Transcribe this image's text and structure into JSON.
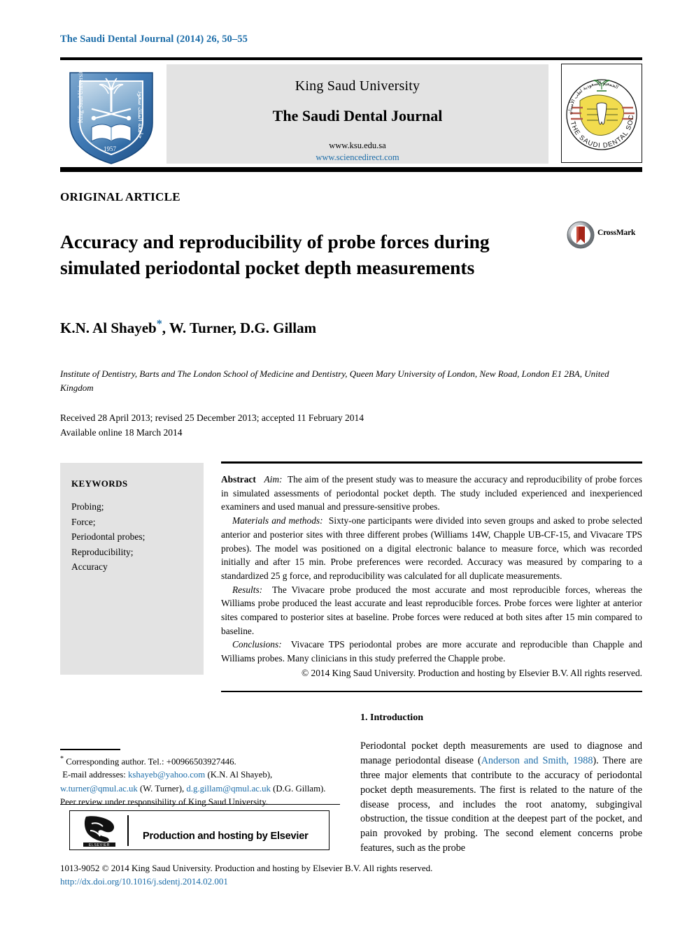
{
  "running_head": "The Saudi Dental Journal (2014) 26, 50–55",
  "masthead": {
    "university": "King Saud University",
    "journal_name": "The Saudi Dental Journal",
    "url_primary": "www.ksu.edu.sa",
    "url_secondary": "www.sciencedirect.com",
    "ksu_logo_name": "King Saud University",
    "ksu_logo_year": "1957",
    "sds_logo_text": "THE SAUDI DENTAL SOCIETY"
  },
  "article": {
    "type": "ORIGINAL ARTICLE",
    "title": "Accuracy and reproducibility of probe forces during simulated periodontal pocket depth measurements",
    "crossmark_label": "CrossMark",
    "authors": "K.N. Al Shayeb",
    "authors_rest": ", W. Turner, D.G. Gillam",
    "corresponding_marker": "*",
    "affiliation": "Institute of Dentistry, Barts and The London School of Medicine and Dentistry, Queen Mary University of London, New Road, London E1 2BA, United Kingdom",
    "received_line": "Received 28 April 2013; revised 25 December 2013; accepted 11 February 2014",
    "available_line": "Available online 18 March 2014"
  },
  "keywords": {
    "title": "KEYWORDS",
    "items": [
      "Probing;",
      "Force;",
      "Periodontal probes;",
      "Reproducibility;",
      "Accuracy"
    ]
  },
  "abstract": {
    "heading": "Abstract",
    "aim_label": "Aim:",
    "aim_text": "The aim of the present study was to measure the accuracy and reproducibility of probe forces in simulated assessments of periodontal pocket depth. The study included experienced and inexperienced examiners and used manual and pressure-sensitive probes.",
    "methods_label": "Materials and methods:",
    "methods_text": "Sixty-one participants were divided into seven groups and asked to probe selected anterior and posterior sites with three different probes (Williams 14W, Chapple UB-CF-15, and Vivacare TPS probes). The model was positioned on a digital electronic balance to measure force, which was recorded initially and after 15 min. Probe preferences were recorded. Accuracy was measured by comparing to a standardized 25 g force, and reproducibility was calculated for all duplicate measurements.",
    "results_label": "Results:",
    "results_text": "The Vivacare probe produced the most accurate and most reproducible forces, whereas the Williams probe produced the least accurate and least reproducible forces. Probe forces were lighter at anterior sites compared to posterior sites at baseline. Probe forces were reduced at both sites after 15 min compared to baseline.",
    "conclusions_label": "Conclusions:",
    "conclusions_text": "Vivacare TPS periodontal probes are more accurate and reproducible than Chapple and Williams probes. Many clinicians in this study preferred the Chapple probe.",
    "copyright": "© 2014 King Saud University. Production and hosting by Elsevier B.V. All rights reserved."
  },
  "introduction": {
    "heading": "1. Introduction",
    "para_part1": "Periodontal pocket depth measurements are used to diagnose and manage periodontal disease (",
    "citation": "Anderson and Smith, 1988",
    "para_part2": "). There are three major elements that contribute to the accuracy of periodontal pocket depth measurements. The first is related to the nature of the disease process, and includes the root anatomy, subgingival obstruction, the tissue condition at the deepest part of the pocket, and pain provoked by probing. The second element concerns probe features, such as the probe"
  },
  "footnotes": {
    "corresponding": "Corresponding author. Tel.: +00966503927446.",
    "email_label": "E-mail addresses:",
    "email1": "kshayeb@yahoo.com",
    "email1_owner": "(K.N. Al Shayeb),",
    "email2": "w.turner@qmul.ac.uk",
    "email2_owner": "(W. Turner),",
    "email3": "d.g.gillam@qmul.ac.uk",
    "email3_owner": "(D.G. Gillam).",
    "peer_review": "Peer review under responsibility of King Saud University."
  },
  "elsevier_badge": {
    "text": "Production and hosting by Elsevier",
    "logo_word": "ELSEVIER"
  },
  "bottom": {
    "issn_line": "1013-9052 © 2014 King Saud University. Production and hosting by Elsevier B.V. All rights reserved.",
    "doi": "http://dx.doi.org/10.1016/j.sdentj.2014.02.001"
  },
  "colors": {
    "link_blue": "#1b6ca8",
    "box_grey": "#e3e3e3",
    "crossmark_red": "#a52518",
    "sds_yellow": "#f2dc4e"
  }
}
